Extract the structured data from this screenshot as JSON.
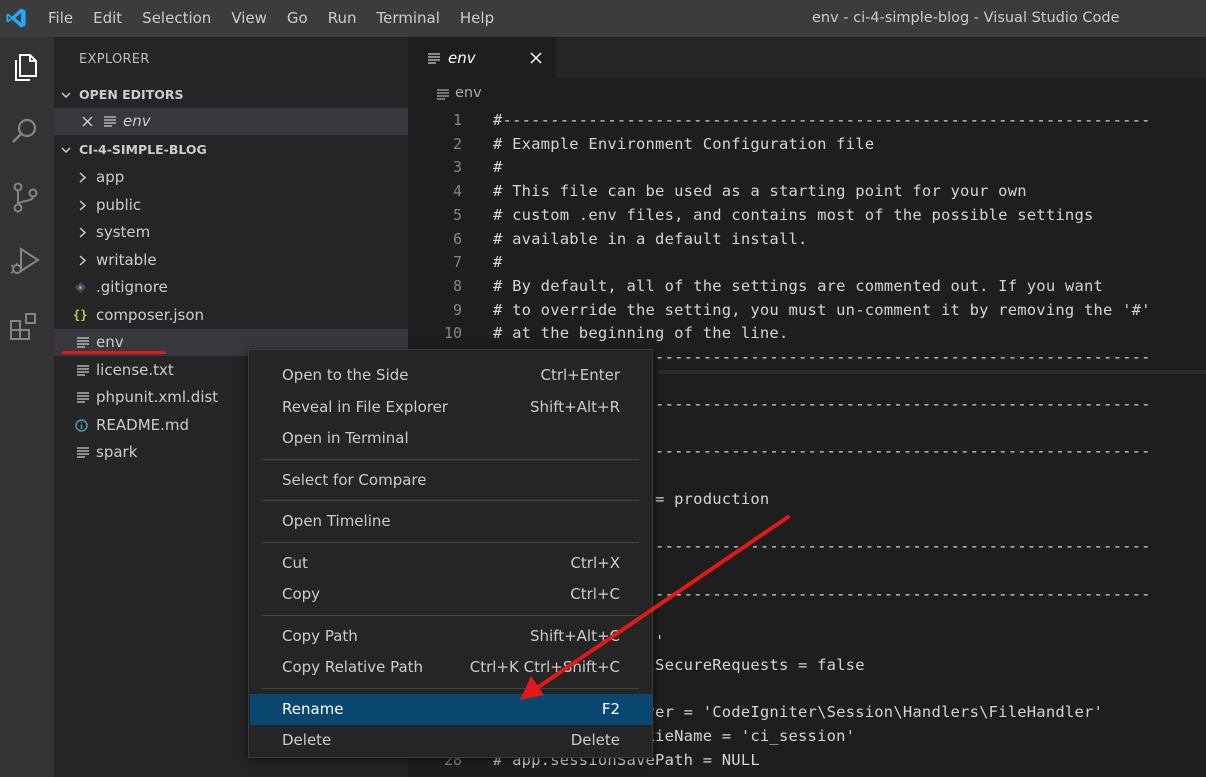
{
  "window": {
    "title": "env - ci-4-simple-blog - Visual Studio Code"
  },
  "menubar": {
    "items": [
      "File",
      "Edit",
      "Selection",
      "View",
      "Go",
      "Run",
      "Terminal",
      "Help"
    ]
  },
  "activitybar": {
    "icons": [
      "explorer-icon",
      "search-icon",
      "source-control-icon",
      "run-debug-icon",
      "extensions-icon"
    ]
  },
  "sidebar": {
    "title": "EXPLORER",
    "open_editors": {
      "header": "OPEN EDITORS",
      "items": [
        {
          "label": "env"
        }
      ]
    },
    "project": {
      "header": "CI-4-SIMPLE-BLOG",
      "items": [
        {
          "label": "app",
          "kind": "folder"
        },
        {
          "label": "public",
          "kind": "folder"
        },
        {
          "label": "system",
          "kind": "folder"
        },
        {
          "label": "writable",
          "kind": "folder"
        },
        {
          "label": ".gitignore",
          "kind": "git"
        },
        {
          "label": "composer.json",
          "kind": "json"
        },
        {
          "label": "env",
          "kind": "file"
        },
        {
          "label": "license.txt",
          "kind": "file"
        },
        {
          "label": "phpunit.xml.dist",
          "kind": "file"
        },
        {
          "label": "README.md",
          "kind": "info"
        },
        {
          "label": "spark",
          "kind": "file"
        }
      ]
    }
  },
  "editor": {
    "tab_label": "env",
    "breadcrumb": "env",
    "lines": [
      {
        "n": "1",
        "text": "#--------------------------------------------------------------------"
      },
      {
        "n": "2",
        "text": "# Example Environment Configuration file"
      },
      {
        "n": "3",
        "text": "#"
      },
      {
        "n": "4",
        "text": "# This file can be used as a starting point for your own"
      },
      {
        "n": "5",
        "text": "# custom .env files, and contains most of the possible settings"
      },
      {
        "n": "6",
        "text": "# available in a default install."
      },
      {
        "n": "7",
        "text": "#"
      },
      {
        "n": "8",
        "text": "# By default, all of the settings are commented out. If you want"
      },
      {
        "n": "9",
        "text": "# to override the setting, you must un-comment it by removing the '#'"
      },
      {
        "n": "10",
        "text": "# at the beginning of the line."
      },
      {
        "n": "",
        "text": "#--------------------------------------------------------------------"
      }
    ],
    "lines_lower": [
      {
        "n": "",
        "text": "#--------------------------------------------------------------------"
      },
      {
        "n": "",
        "text": ""
      },
      {
        "n": "",
        "text": "#--------------------------------------------------------------------"
      },
      {
        "n": "",
        "text": ""
      },
      {
        "n": "",
        "text": "# CI_ENVIRONMENT = production"
      },
      {
        "n": "",
        "text": ""
      },
      {
        "n": "",
        "text": "#--------------------------------------------------------------------"
      },
      {
        "n": "",
        "text": ""
      },
      {
        "n": "",
        "text": "#--------------------------------------------------------------------"
      },
      {
        "n": "",
        "text": ""
      },
      {
        "n": "",
        "text": "# app.baseURL = ''"
      },
      {
        "n": "",
        "text": "# app.forceGlobalSecureRequests = false"
      },
      {
        "n": "",
        "text": ""
      },
      {
        "n": "",
        "text": "# app.sessionDriver = 'CodeIgniter\\Session\\Handlers\\FileHandler'"
      },
      {
        "n": "",
        "text": "# app.sessionCookieName = 'ci_session'"
      },
      {
        "n": "28",
        "text": "# app.sessionSavePath = NULL"
      }
    ]
  },
  "context_menu": {
    "groups": [
      [
        {
          "label": "Open to the Side",
          "key": "Ctrl+Enter"
        },
        {
          "label": "Reveal in File Explorer",
          "key": "Shift+Alt+R"
        },
        {
          "label": "Open in Terminal",
          "key": ""
        }
      ],
      [
        {
          "label": "Select for Compare",
          "key": ""
        }
      ],
      [
        {
          "label": "Open Timeline",
          "key": ""
        }
      ],
      [
        {
          "label": "Cut",
          "key": "Ctrl+X"
        },
        {
          "label": "Copy",
          "key": "Ctrl+C"
        }
      ],
      [
        {
          "label": "Copy Path",
          "key": "Shift+Alt+C"
        },
        {
          "label": "Copy Relative Path",
          "key": "Ctrl+K Ctrl+Shift+C"
        }
      ],
      [
        {
          "label": "Rename",
          "key": "F2",
          "active": true
        },
        {
          "label": "Delete",
          "key": "Delete"
        }
      ]
    ]
  },
  "colors": {
    "accent_active": "#094771",
    "annotation_red": "#e11919",
    "vscode_blue": "#23a9f2"
  }
}
